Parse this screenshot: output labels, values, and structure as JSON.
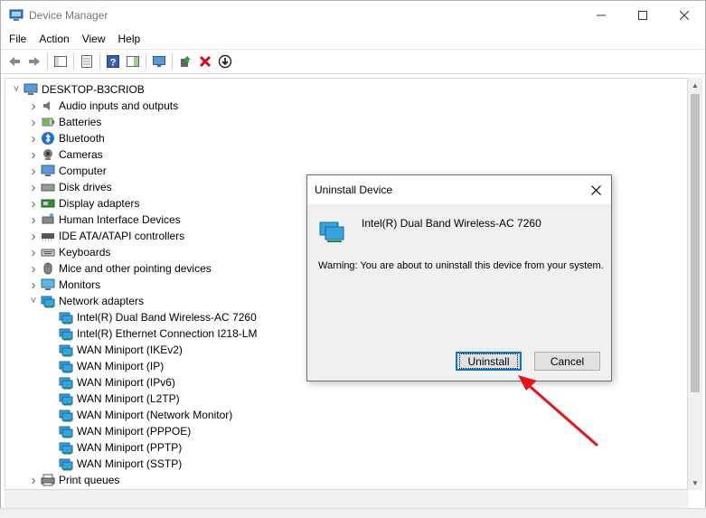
{
  "window": {
    "title": "Device Manager"
  },
  "menu": [
    "File",
    "Action",
    "View",
    "Help"
  ],
  "tree": {
    "root": "DESKTOP-B3CRIOB",
    "categories": [
      {
        "label": "Audio inputs and outputs",
        "icon": "speaker-icon"
      },
      {
        "label": "Batteries",
        "icon": "battery-icon"
      },
      {
        "label": "Bluetooth",
        "icon": "bluetooth-icon"
      },
      {
        "label": "Cameras",
        "icon": "camera-icon"
      },
      {
        "label": "Computer",
        "icon": "computer-icon"
      },
      {
        "label": "Disk drives",
        "icon": "disk-drive-icon"
      },
      {
        "label": "Display adapters",
        "icon": "display-adapter-icon"
      },
      {
        "label": "Human Interface Devices",
        "icon": "hid-icon"
      },
      {
        "label": "IDE ATA/ATAPI controllers",
        "icon": "ide-controller-icon"
      },
      {
        "label": "Keyboards",
        "icon": "keyboard-icon"
      },
      {
        "label": "Mice and other pointing devices",
        "icon": "mouse-icon"
      },
      {
        "label": "Monitors",
        "icon": "monitor-icon"
      },
      {
        "label": "Network adapters",
        "icon": "network-adapter-icon",
        "expanded": true
      }
    ],
    "network_children": [
      "Intel(R) Dual Band Wireless-AC 7260",
      "Intel(R) Ethernet Connection I218-LM",
      "WAN Miniport (IKEv2)",
      "WAN Miniport (IP)",
      "WAN Miniport (IPv6)",
      "WAN Miniport (L2TP)",
      "WAN Miniport (Network Monitor)",
      "WAN Miniport (PPPOE)",
      "WAN Miniport (PPTP)",
      "WAN Miniport (SSTP)"
    ],
    "after": [
      {
        "label": "Print queues",
        "icon": "printer-icon"
      }
    ]
  },
  "dialog": {
    "title": "Uninstall Device",
    "device_name": "Intel(R) Dual Band Wireless-AC 7260",
    "warning": "Warning: You are about to uninstall this device from your system.",
    "uninstall_label": "Uninstall",
    "cancel_label": "Cancel"
  },
  "colors": {
    "accent": "#0078d7",
    "annotation_arrow": "#e8141b"
  }
}
